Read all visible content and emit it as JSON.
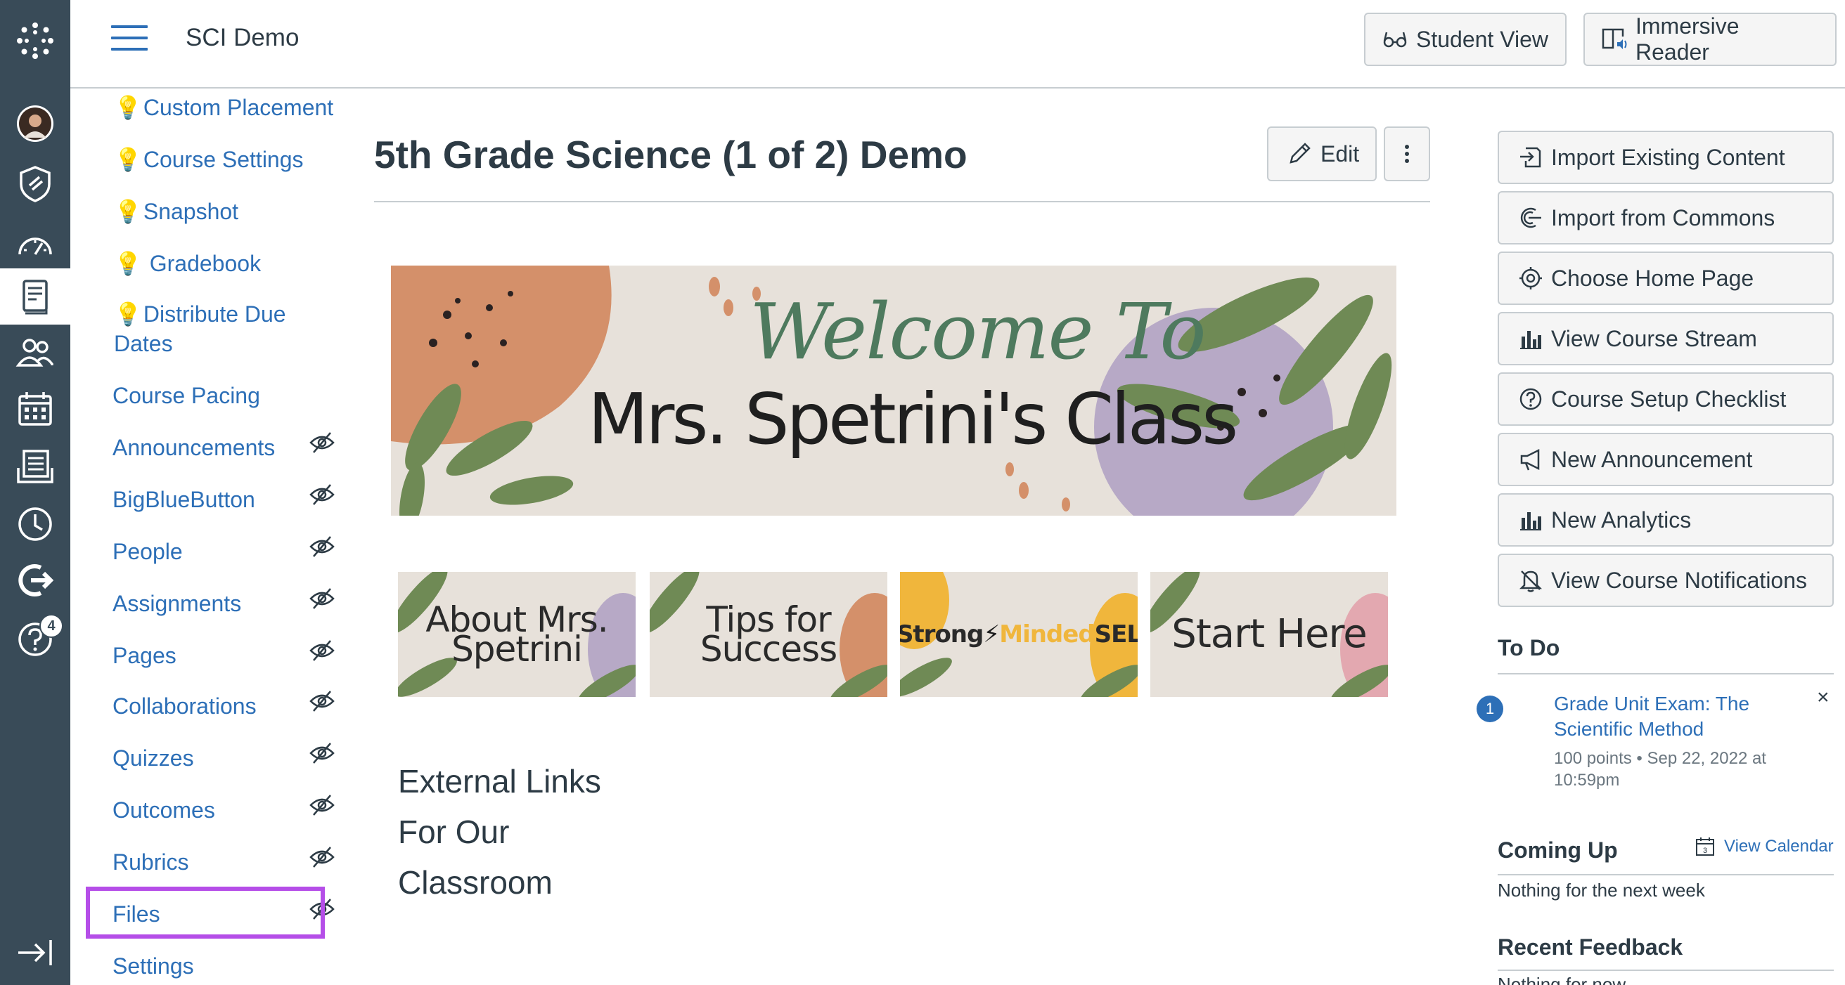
{
  "header": {
    "course_title": "SCI Demo",
    "student_view": "Student View",
    "immersive_reader": "Immersive Reader"
  },
  "global_nav": {
    "help_badge": "4"
  },
  "course_nav": {
    "items": [
      {
        "label": "Custom Placement",
        "bulb": true
      },
      {
        "label": "Course Settings",
        "bulb": true
      },
      {
        "label": "Snapshot",
        "bulb": true
      },
      {
        "label": "Gradebook",
        "bulb": true
      },
      {
        "label": "Distribute Due",
        "label2": "Dates",
        "bulb": true
      },
      {
        "label": "Course Pacing"
      },
      {
        "label": "Announcements",
        "hidden": true
      },
      {
        "label": "BigBlueButton",
        "hidden": true
      },
      {
        "label": "People",
        "hidden": true
      },
      {
        "label": "Assignments",
        "hidden": true
      },
      {
        "label": "Pages",
        "hidden": true
      },
      {
        "label": "Collaborations",
        "hidden": true
      },
      {
        "label": "Quizzes",
        "hidden": true
      },
      {
        "label": "Outcomes",
        "hidden": true
      },
      {
        "label": "Rubrics",
        "hidden": true
      },
      {
        "label": "Files",
        "hidden": true
      },
      {
        "label": "Settings"
      }
    ]
  },
  "main": {
    "page_title": "5th Grade Science (1 of 2) Demo",
    "edit_label": "Edit",
    "banner": {
      "line1": "Welcome To",
      "line2": "Mrs. Spetrini's Class"
    },
    "thumbnails": [
      {
        "line1": "About Mrs.",
        "line2": "Spetrini"
      },
      {
        "line1": "Tips for",
        "line2": "Success"
      },
      {
        "line1": "Strong",
        "mid": "Minded",
        "line2": "SEL"
      },
      {
        "line1": "Start Here",
        "line2": ""
      }
    ],
    "external_links": [
      "External Links",
      "For Our",
      "Classroom"
    ]
  },
  "sidebar": {
    "buttons": [
      {
        "label": "Import Existing Content",
        "icon": "import-icon"
      },
      {
        "label": "Import from Commons",
        "icon": "commons-icon"
      },
      {
        "label": "Choose Home Page",
        "icon": "target-icon"
      },
      {
        "label": "View Course Stream",
        "icon": "bar-chart-icon"
      },
      {
        "label": "Course Setup Checklist",
        "icon": "question-icon"
      },
      {
        "label": "New Announcement",
        "icon": "megaphone-icon"
      },
      {
        "label": "New Analytics",
        "icon": "bar-chart-icon"
      },
      {
        "label": "View Course Notifications",
        "icon": "bell-icon"
      }
    ],
    "todo": {
      "heading": "To Do",
      "count": "1",
      "item_title": "Grade Unit Exam: The Scientific Method",
      "item_meta": "100 points • Sep 22, 2022 at 10:59pm",
      "close": "×"
    },
    "coming_up": {
      "heading": "Coming Up",
      "calendar_link": "View Calendar",
      "calendar_day": "3",
      "text": "Nothing for the next week"
    },
    "recent_feedback": {
      "heading": "Recent Feedback",
      "text": "Nothing for now"
    }
  },
  "colors": {
    "nav_bg": "#394b58",
    "link": "#2d6fb7",
    "highlight": "#b54ee8"
  }
}
